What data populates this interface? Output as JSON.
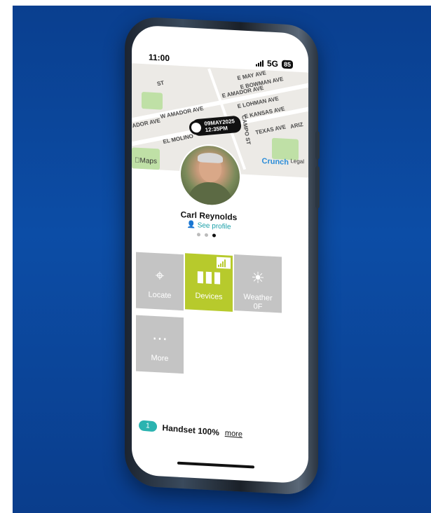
{
  "status_bar": {
    "time": "11:00",
    "network": "5G",
    "battery": "85"
  },
  "map": {
    "brand": "Maps",
    "poi": "Crunch",
    "legal": "Legal",
    "streets": [
      "E MAY AVE",
      "E BOWMAN AVE",
      "E AMADOR AVE",
      "E LOHMAN AVE",
      "E KANSAS AVE",
      "W AMADOR AVE",
      "TEXAS AVE",
      "EL MOLINO",
      "CAMPO ST",
      "ARIZ",
      "ADOR AVE",
      "ST"
    ]
  },
  "pin": {
    "date": "09MAY2025",
    "time": "12:35PM"
  },
  "profile": {
    "name": "Carl Reynolds",
    "see_profile": "See profile",
    "page_count": 3,
    "active_page": 3
  },
  "tiles": [
    {
      "label": "Locate",
      "icon": "crosshair-icon"
    },
    {
      "label": "Devices",
      "icon": "battery-icon",
      "color": "#b7ca2c"
    },
    {
      "label": "Weather",
      "sub": "0F",
      "icon": "sun-icon"
    },
    {
      "label": "More",
      "icon": "ellipsis-icon"
    }
  ],
  "footer": {
    "badge": "1",
    "status": "Handset 100%",
    "more": "more"
  },
  "colors": {
    "accent": "#b7ca2c",
    "teal": "#2bb3b0",
    "tile_gray": "#c4c4c4",
    "background": "#0c4da6"
  }
}
